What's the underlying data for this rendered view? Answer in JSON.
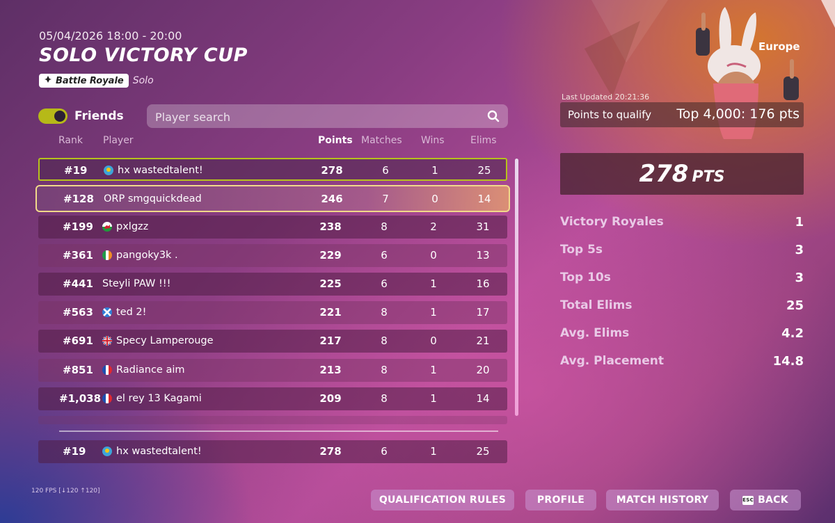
{
  "header": {
    "date_range": "05/04/2026 18:00 - 20:00",
    "title": "SOLO VICTORY CUP",
    "mode_badge": "Battle Royale",
    "mode_sub": "Solo"
  },
  "filters": {
    "friends_label": "Friends",
    "friends_toggle_on": true,
    "search_placeholder": "Player search"
  },
  "columns": {
    "rank": "Rank",
    "player": "Player",
    "points": "Points",
    "matches": "Matches",
    "wins": "Wins",
    "elims": "Elims"
  },
  "rows": [
    {
      "rank": "#19",
      "player": "hx wastedtalent!",
      "flag": "kazakhstan",
      "points": "278",
      "matches": "6",
      "wins": "1",
      "elims": "25"
    },
    {
      "rank": "#128",
      "player": "ORP smgquickdead",
      "flag": "",
      "points": "246",
      "matches": "7",
      "wins": "0",
      "elims": "14"
    },
    {
      "rank": "#199",
      "player": "pxlgzz",
      "flag": "wales",
      "points": "238",
      "matches": "8",
      "wins": "2",
      "elims": "31"
    },
    {
      "rank": "#361",
      "player": "pangoky3k .",
      "flag": "ireland",
      "points": "229",
      "matches": "6",
      "wins": "0",
      "elims": "13"
    },
    {
      "rank": "#441",
      "player": "Steyli PAW !!!",
      "flag": "",
      "points": "225",
      "matches": "6",
      "wins": "1",
      "elims": "16"
    },
    {
      "rank": "#563",
      "player": "ted 2!",
      "flag": "scotland",
      "points": "221",
      "matches": "8",
      "wins": "1",
      "elims": "17"
    },
    {
      "rank": "#691",
      "player": "Specy Lamperouge",
      "flag": "united-kingdom",
      "points": "217",
      "matches": "8",
      "wins": "0",
      "elims": "21"
    },
    {
      "rank": "#851",
      "player": "Radiance aim",
      "flag": "france",
      "points": "213",
      "matches": "8",
      "wins": "1",
      "elims": "20"
    },
    {
      "rank": "#1,038",
      "player": "el rey 13 Kagami",
      "flag": "france",
      "points": "209",
      "matches": "8",
      "wins": "1",
      "elims": "14"
    }
  ],
  "self_row": {
    "rank": "#19",
    "player": "hx wastedtalent!",
    "flag": "kazakhstan",
    "points": "278",
    "matches": "6",
    "wins": "1",
    "elims": "25"
  },
  "summary": {
    "region": "Europe",
    "last_updated": "Last Updated 20:21:36",
    "qualify_label": "Points to qualify",
    "qualify_value": "Top 4,000: 176 pts",
    "points_value": "278",
    "points_unit": "PTS",
    "stats": [
      {
        "label": "Victory Royales",
        "value": "1"
      },
      {
        "label": "Top 5s",
        "value": "3"
      },
      {
        "label": "Top 10s",
        "value": "3"
      },
      {
        "label": "Total Elims",
        "value": "25"
      },
      {
        "label": "Avg. Elims",
        "value": "4.2"
      },
      {
        "label": "Avg. Placement",
        "value": "14.8"
      }
    ]
  },
  "footer": {
    "fps": "120 FPS [↓120 ↑120]",
    "qualification_rules": "QUALIFICATION RULES",
    "profile": "PROFILE",
    "match_history": "MATCH HISTORY",
    "esc_key": "ESC",
    "back": "BACK"
  },
  "colors": {
    "accent_toggle": "#b6b918",
    "highlight_green": "#b6c21c",
    "highlight_gold": "#f1d98a"
  }
}
